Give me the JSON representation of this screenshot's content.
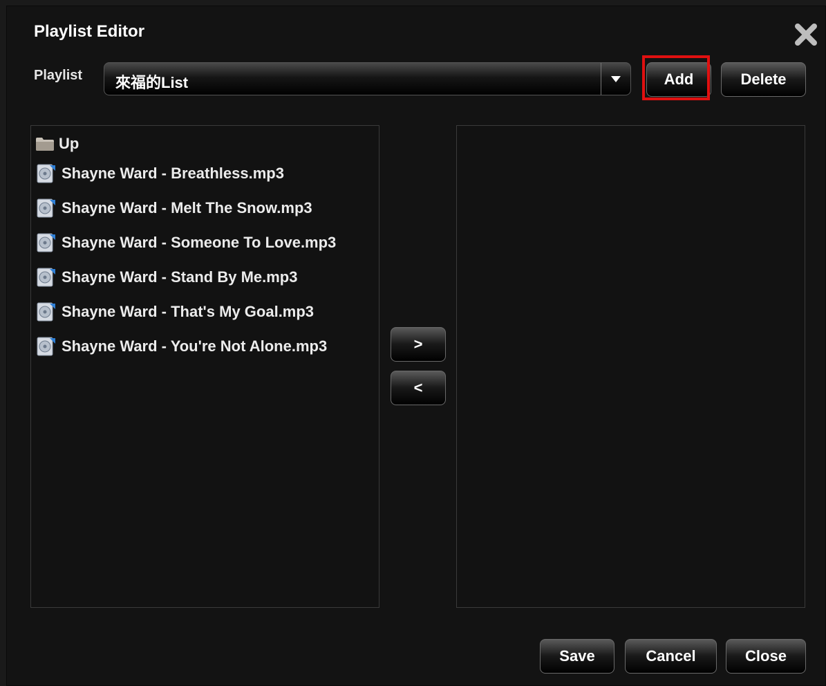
{
  "dialog": {
    "title": "Playlist Editor",
    "close_icon": "close-x-icon"
  },
  "playlist": {
    "label": "Playlist",
    "selected": "來福的List",
    "add_label": "Add",
    "delete_label": "Delete"
  },
  "files": [
    {
      "name": "Up",
      "icon": "folder-icon"
    },
    {
      "name": "Shayne Ward - Breathless.mp3",
      "icon": "audio-file-icon"
    },
    {
      "name": "Shayne Ward - Melt The Snow.mp3",
      "icon": "audio-file-icon"
    },
    {
      "name": "Shayne Ward - Someone To Love.mp3",
      "icon": "audio-file-icon"
    },
    {
      "name": "Shayne Ward - Stand By Me.mp3",
      "icon": "audio-file-icon"
    },
    {
      "name": "Shayne Ward - That's My Goal.mp3",
      "icon": "audio-file-icon"
    },
    {
      "name": "Shayne Ward - You're Not Alone.mp3",
      "icon": "audio-file-icon"
    }
  ],
  "playlist_items": [],
  "transfer": {
    "add_to_playlist": ">",
    "remove_from_playlist": "<"
  },
  "footer": {
    "save_label": "Save",
    "cancel_label": "Cancel",
    "close_label": "Close"
  },
  "colors": {
    "highlight": "#e01010",
    "background": "#131313"
  }
}
